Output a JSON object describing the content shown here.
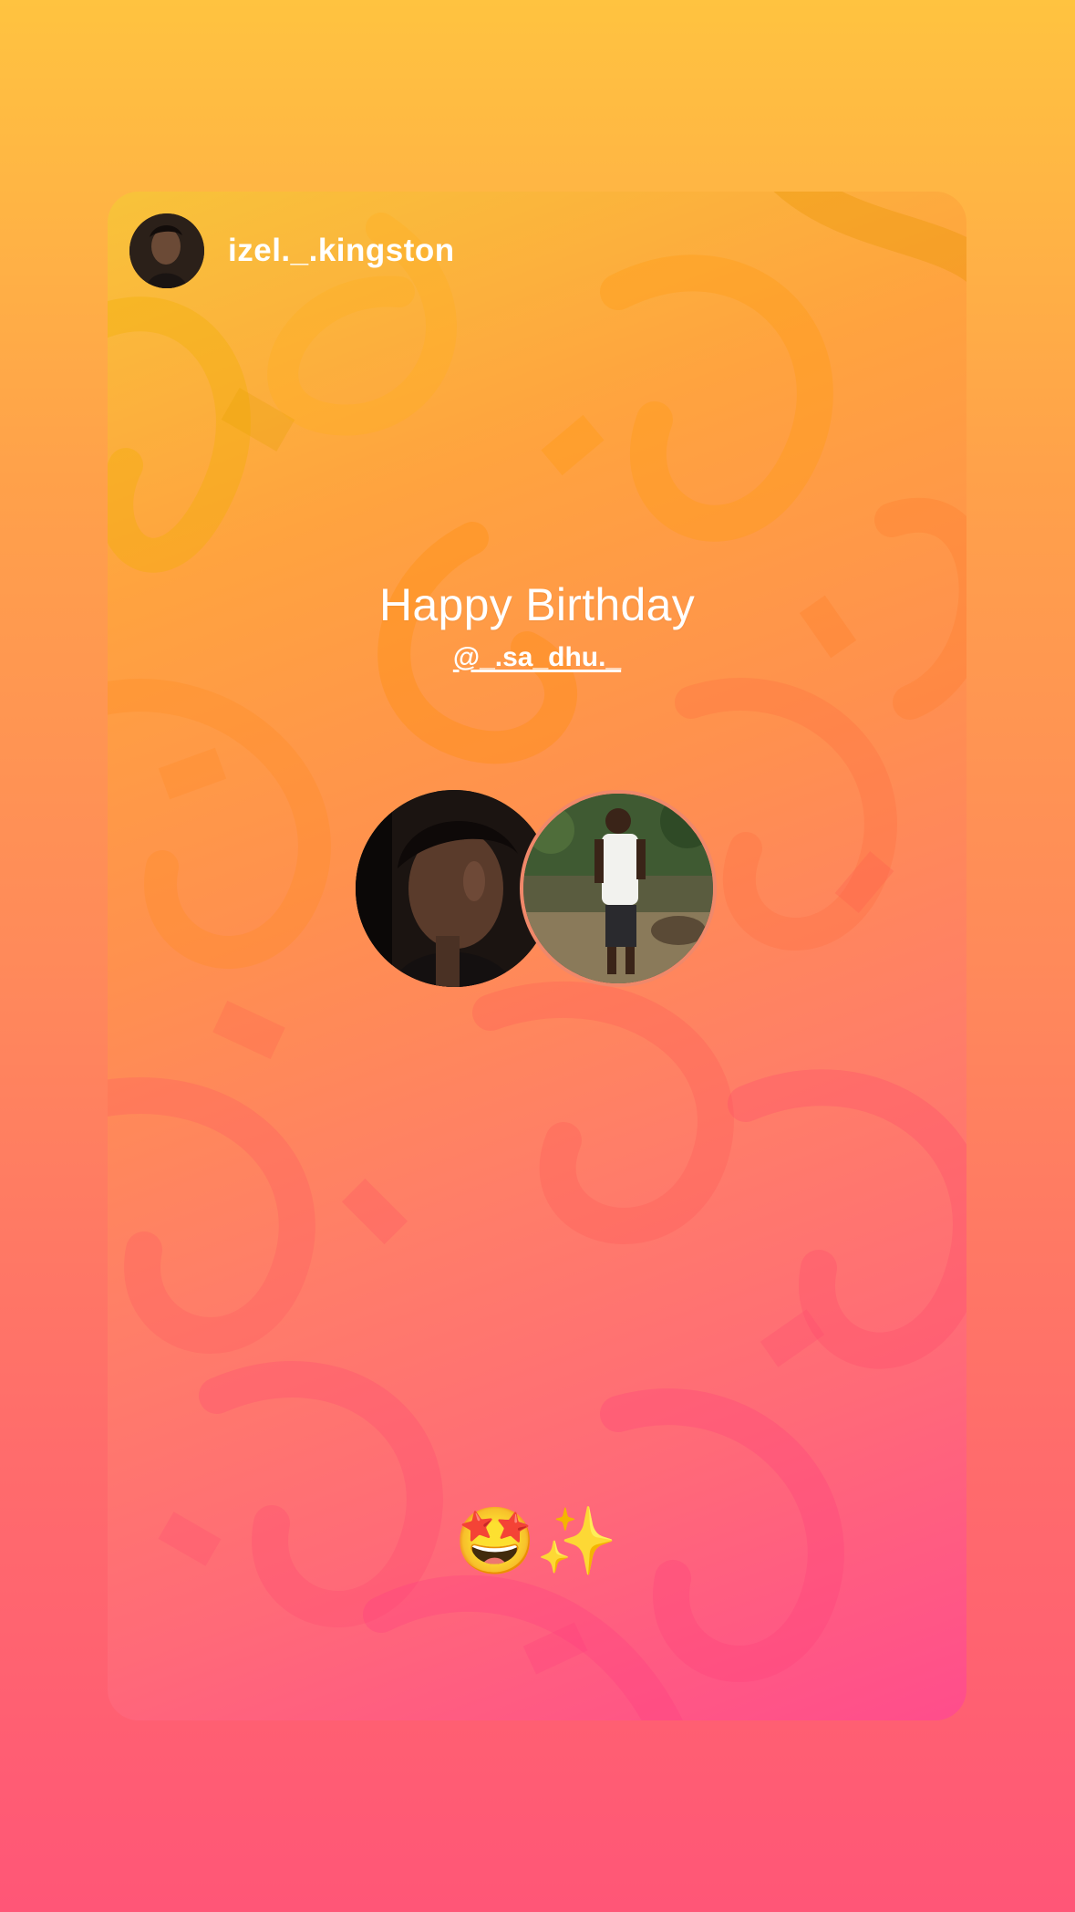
{
  "story": {
    "author": {
      "username": "izel._.kingston",
      "avatar": "profile-photo"
    },
    "title": "Happy Birthday",
    "mention": "@_.sa_dhu._",
    "photos": [
      "portrait-photo",
      "standing-photo"
    ],
    "sticker": "🤩✨"
  },
  "colors": {
    "background_top": "#ffc340",
    "background_bottom": "#ff5677",
    "card_top": "#f8c33a",
    "card_bottom": "#ff4d8c",
    "text": "#ffffff"
  }
}
